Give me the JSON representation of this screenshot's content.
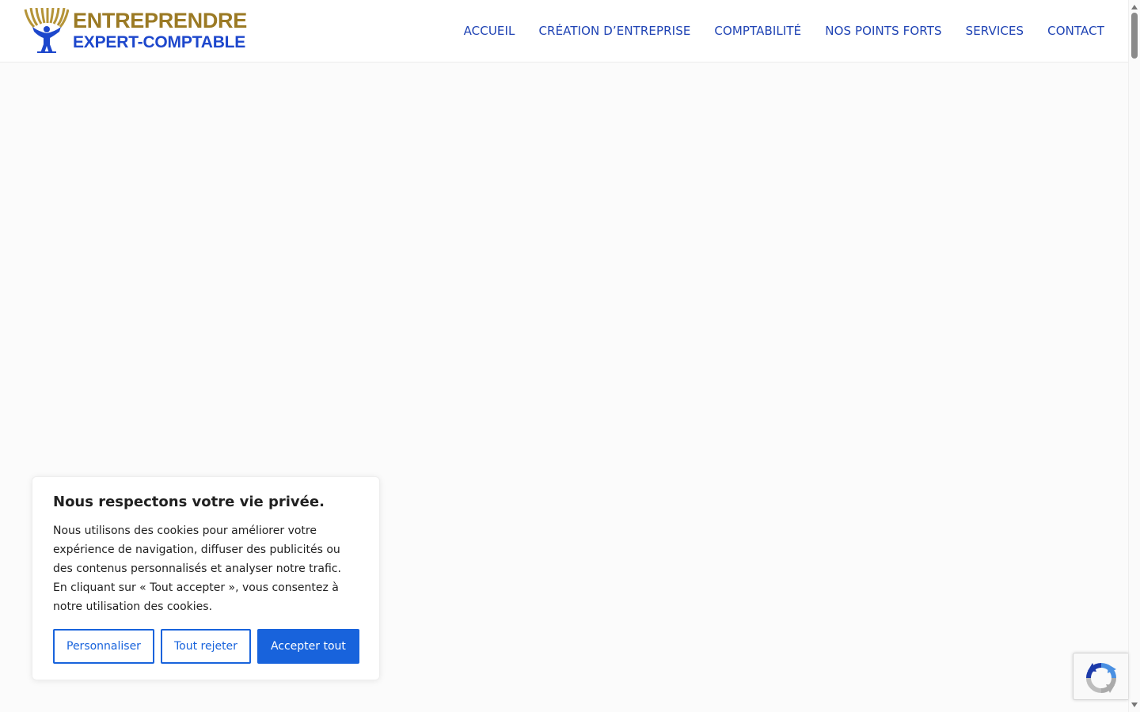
{
  "brand": {
    "name_line1": "ENTREPRENDRE",
    "name_line2": "EXPERT-COMPTABLE",
    "gold": "#9b7a24",
    "blue": "#1d47cc"
  },
  "nav": {
    "items": [
      {
        "label": "ACCUEIL"
      },
      {
        "label": "CRÉATION D’ENTREPRISE"
      },
      {
        "label": "COMPTABILITÉ"
      },
      {
        "label": "NOS POINTS FORTS"
      },
      {
        "label": "SERVICES"
      },
      {
        "label": "CONTACT"
      }
    ],
    "color": "#1f43b4"
  },
  "cookie_banner": {
    "title": "Nous respectons votre vie privée.",
    "text": "Nous utilisons des cookies pour améliorer votre expérience de navigation, diffuser des publicités ou des contenus personnalisés et analyser notre trafic. En cliquant sur « Tout accepter », vous consentez à notre utilisation des cookies.",
    "buttons": {
      "customize": "Personnaliser",
      "reject": "Tout rejeter",
      "accept": "Accepter tout"
    },
    "accent": "#1863dc"
  },
  "recaptcha": {
    "icon": "recaptcha-icon"
  },
  "page": {
    "background": "#fbfbfb"
  }
}
